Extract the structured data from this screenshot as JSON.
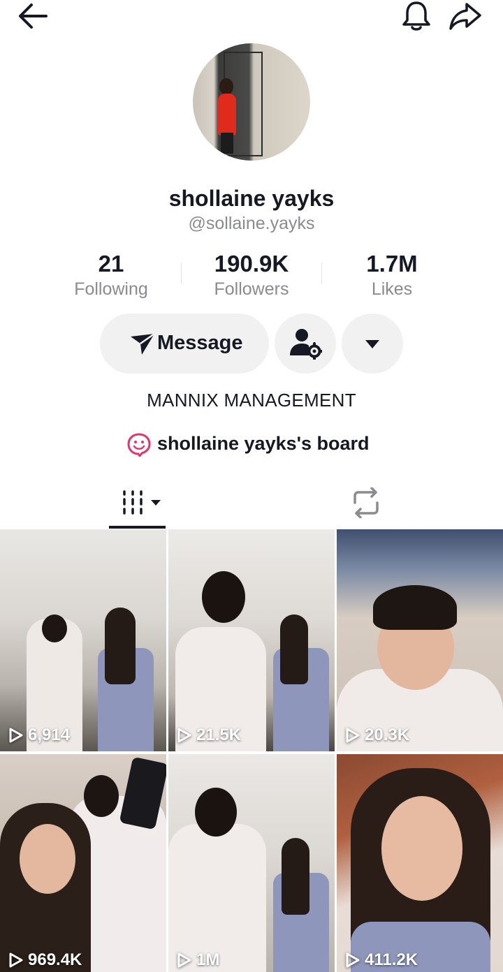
{
  "header": {
    "back_icon": "arrow-left-icon",
    "bell_icon": "bell-icon",
    "share_icon": "share-arrow-icon"
  },
  "profile": {
    "display_name": "shollaine yayks",
    "username": "@sollaine.yayks",
    "bio": "MANNIX MANAGEMENT",
    "board_label": "shollaine yayks's board"
  },
  "stats": [
    {
      "value": "21",
      "label": "Following"
    },
    {
      "value": "190.9K",
      "label": "Followers"
    },
    {
      "value": "1.7M",
      "label": "Likes"
    }
  ],
  "actions": {
    "message_label": "Message",
    "follow_icon": "user-settings-icon",
    "more_icon": "caret-down-icon"
  },
  "tabs": {
    "videos_icon": "grid-videos-icon",
    "reposts_icon": "repost-icon"
  },
  "videos": [
    {
      "views": "6,914"
    },
    {
      "views": "21.5K"
    },
    {
      "views": "20.3K"
    },
    {
      "views": "969.4K"
    },
    {
      "views": "1M"
    },
    {
      "views": "411.2K"
    }
  ],
  "colors": {
    "text": "#161823",
    "secondary": "#8a8b91",
    "button_bg": "#f1f1f2",
    "board_accent": "#e6336b"
  }
}
